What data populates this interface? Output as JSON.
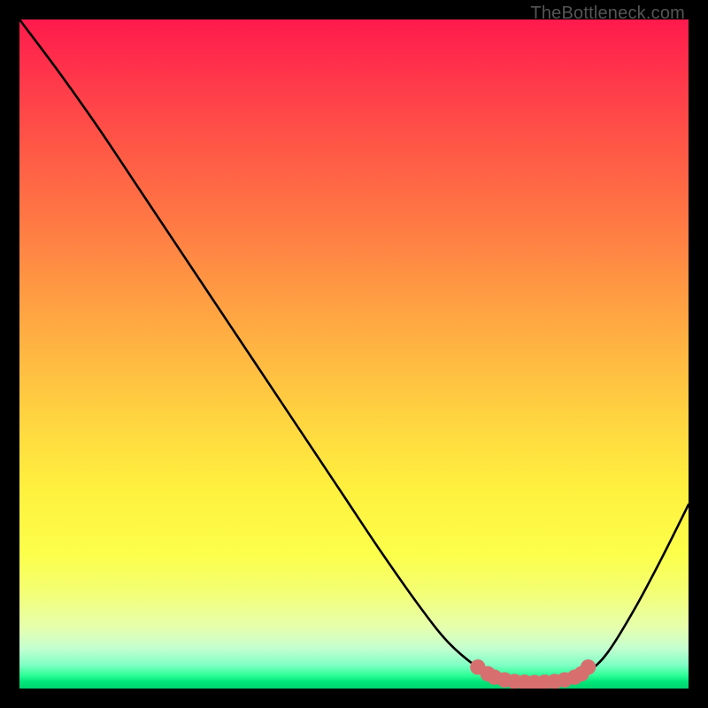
{
  "watermark": "TheBottleneck.com",
  "chart_data": {
    "type": "line",
    "title": "",
    "xlabel": "",
    "ylabel": "",
    "xlim": [
      0,
      100
    ],
    "ylim": [
      0,
      100
    ],
    "curve_points": [
      {
        "x": 0,
        "y": 100
      },
      {
        "x": 6,
        "y": 92
      },
      {
        "x": 12,
        "y": 83.5
      },
      {
        "x": 18,
        "y": 74.5
      },
      {
        "x": 24,
        "y": 65.5
      },
      {
        "x": 30,
        "y": 56.5
      },
      {
        "x": 36,
        "y": 47.5
      },
      {
        "x": 42,
        "y": 38.5
      },
      {
        "x": 48,
        "y": 29.5
      },
      {
        "x": 54,
        "y": 20.5
      },
      {
        "x": 60,
        "y": 12.0
      },
      {
        "x": 64,
        "y": 7.0
      },
      {
        "x": 68,
        "y": 3.5
      },
      {
        "x": 71,
        "y": 1.8
      },
      {
        "x": 74,
        "y": 1.0
      },
      {
        "x": 78,
        "y": 0.9
      },
      {
        "x": 82,
        "y": 1.2
      },
      {
        "x": 85,
        "y": 2.5
      },
      {
        "x": 88,
        "y": 5.5
      },
      {
        "x": 92,
        "y": 12.0
      },
      {
        "x": 96,
        "y": 19.5
      },
      {
        "x": 100,
        "y": 27.5
      }
    ],
    "min_marker_points": [
      {
        "x": 68.5,
        "y": 3.2
      },
      {
        "x": 70.0,
        "y": 2.2
      },
      {
        "x": 71.0,
        "y": 1.7
      },
      {
        "x": 72.5,
        "y": 1.3
      },
      {
        "x": 74.0,
        "y": 1.05
      },
      {
        "x": 75.5,
        "y": 0.95
      },
      {
        "x": 77.0,
        "y": 0.9
      },
      {
        "x": 78.5,
        "y": 0.95
      },
      {
        "x": 80.0,
        "y": 1.05
      },
      {
        "x": 81.5,
        "y": 1.3
      },
      {
        "x": 83.0,
        "y": 1.7
      },
      {
        "x": 84.0,
        "y": 2.2
      },
      {
        "x": 85.0,
        "y": 3.2
      }
    ],
    "marker_radius": 1.15,
    "colors": {
      "curve": "#000000",
      "markers": "#d86f6f",
      "gradient_top": "#ff1a4d",
      "gradient_bottom": "#00d46e"
    }
  }
}
